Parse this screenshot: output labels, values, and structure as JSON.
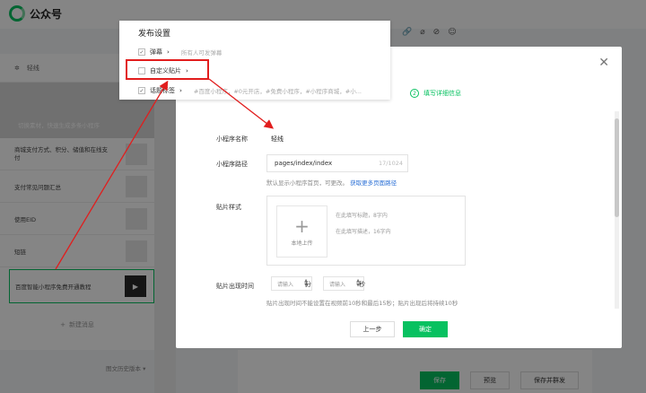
{
  "app": {
    "title": "公众号"
  },
  "toolbar_icons": [
    "link-icon",
    "paperclip-icon",
    "no-entry-icon",
    "emoji-icon"
  ],
  "editor": {
    "account_label": "轻线",
    "cover_hint": "切换素材，快速生成多条小程序",
    "articles": [
      {
        "title": "商城支付方式、积分、储值和在线支付",
        "thumb": ""
      },
      {
        "title": "支付常见问题汇总",
        "thumb": ""
      },
      {
        "title": "使用EID",
        "thumb": ""
      },
      {
        "title": "短链",
        "thumb": ""
      },
      {
        "title": "百度智能小程序免费开通教程",
        "thumb": "▶"
      }
    ],
    "new_message": "新建消息",
    "history": "图文历史版本 ▾"
  },
  "bottom_actions": {
    "save": "保存",
    "preview": "预览",
    "save_and_send": "保存并群发"
  },
  "publish_popup": {
    "title": "发布设置",
    "rows": [
      {
        "label": "弹幕",
        "sub": "所有人可发弹幕",
        "checked": true
      },
      {
        "label": "自定义贴片",
        "sub": "",
        "checked": false
      },
      {
        "label": "话题标签",
        "sub": "#百度小程序，#0元开店，#免费小程序，#小程序商城，#小...",
        "checked": true
      }
    ]
  },
  "modal": {
    "step_number": "2",
    "step_label": "填写详细信息",
    "mp_name_label": "小程序名称",
    "mp_name_value": "轻线",
    "path_label": "小程序路径",
    "path_value": "pages/index/index",
    "path_count": "17/1024",
    "path_hint": "默认显示小程序首页，可更改。",
    "path_link": "获取更多页面路径",
    "style_label": "贴片样式",
    "upload_label": "本地上传",
    "title_placeholder": "在此填写标题，8字内",
    "desc_placeholder": "在此填写描述，16字内",
    "time_label": "贴片出现时间",
    "minute_placeholder": "请输入",
    "minute_unit": "分",
    "second_placeholder": "请输入",
    "second_unit": "秒",
    "time_hint": "贴片出现时间不能设置在视频前10秒和最后15秒；贴片出现后将持续10秒",
    "prev_button": "上一步",
    "confirm_button": "确定"
  },
  "colors": {
    "accent": "#07c160",
    "annotation": "#e11d1d",
    "link": "#2a6fd6"
  }
}
